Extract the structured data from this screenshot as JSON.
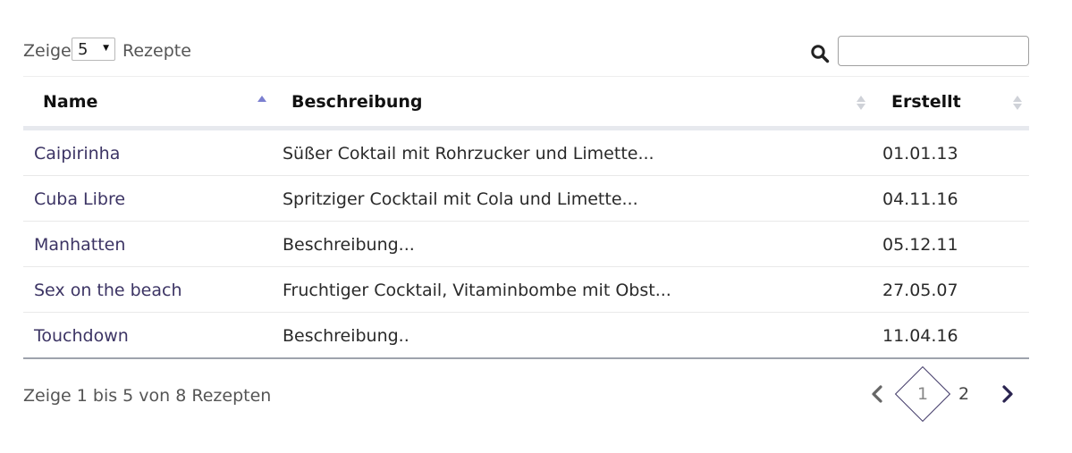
{
  "length_menu": {
    "prefix": "Zeige",
    "selected": "5",
    "suffix": "Rezepte"
  },
  "search": {
    "placeholder": "",
    "value": ""
  },
  "table": {
    "columns": [
      {
        "label": "Name",
        "sort": "ascending"
      },
      {
        "label": "Beschreibung",
        "sort": "none"
      },
      {
        "label": "Erstellt",
        "sort": "none"
      }
    ],
    "rows": [
      {
        "name": "Caipirinha",
        "description": "Süßer Coktail mit Rohrzucker und Limette...",
        "created": "01.01.13"
      },
      {
        "name": "Cuba Libre",
        "description": "Spritziger Cocktail mit Cola und Limette...",
        "created": "04.11.16"
      },
      {
        "name": "Manhatten",
        "description": "Beschreibung...",
        "created": "05.12.11"
      },
      {
        "name": "Sex on the beach",
        "description": "Fruchtiger Cocktail, Vitaminbombe mit Obst...",
        "created": "27.05.07"
      },
      {
        "name": "Touchdown",
        "description": "Beschreibung..",
        "created": "11.04.16"
      }
    ]
  },
  "info": "Zeige 1 bis 5 von 8 Rezepten",
  "pagination": {
    "pages": [
      "1",
      "2"
    ],
    "current": "1"
  },
  "colors": {
    "accent": "#3c3464",
    "sort_active": "#7b7fd0",
    "sort_inactive": "#cfd2d8"
  }
}
